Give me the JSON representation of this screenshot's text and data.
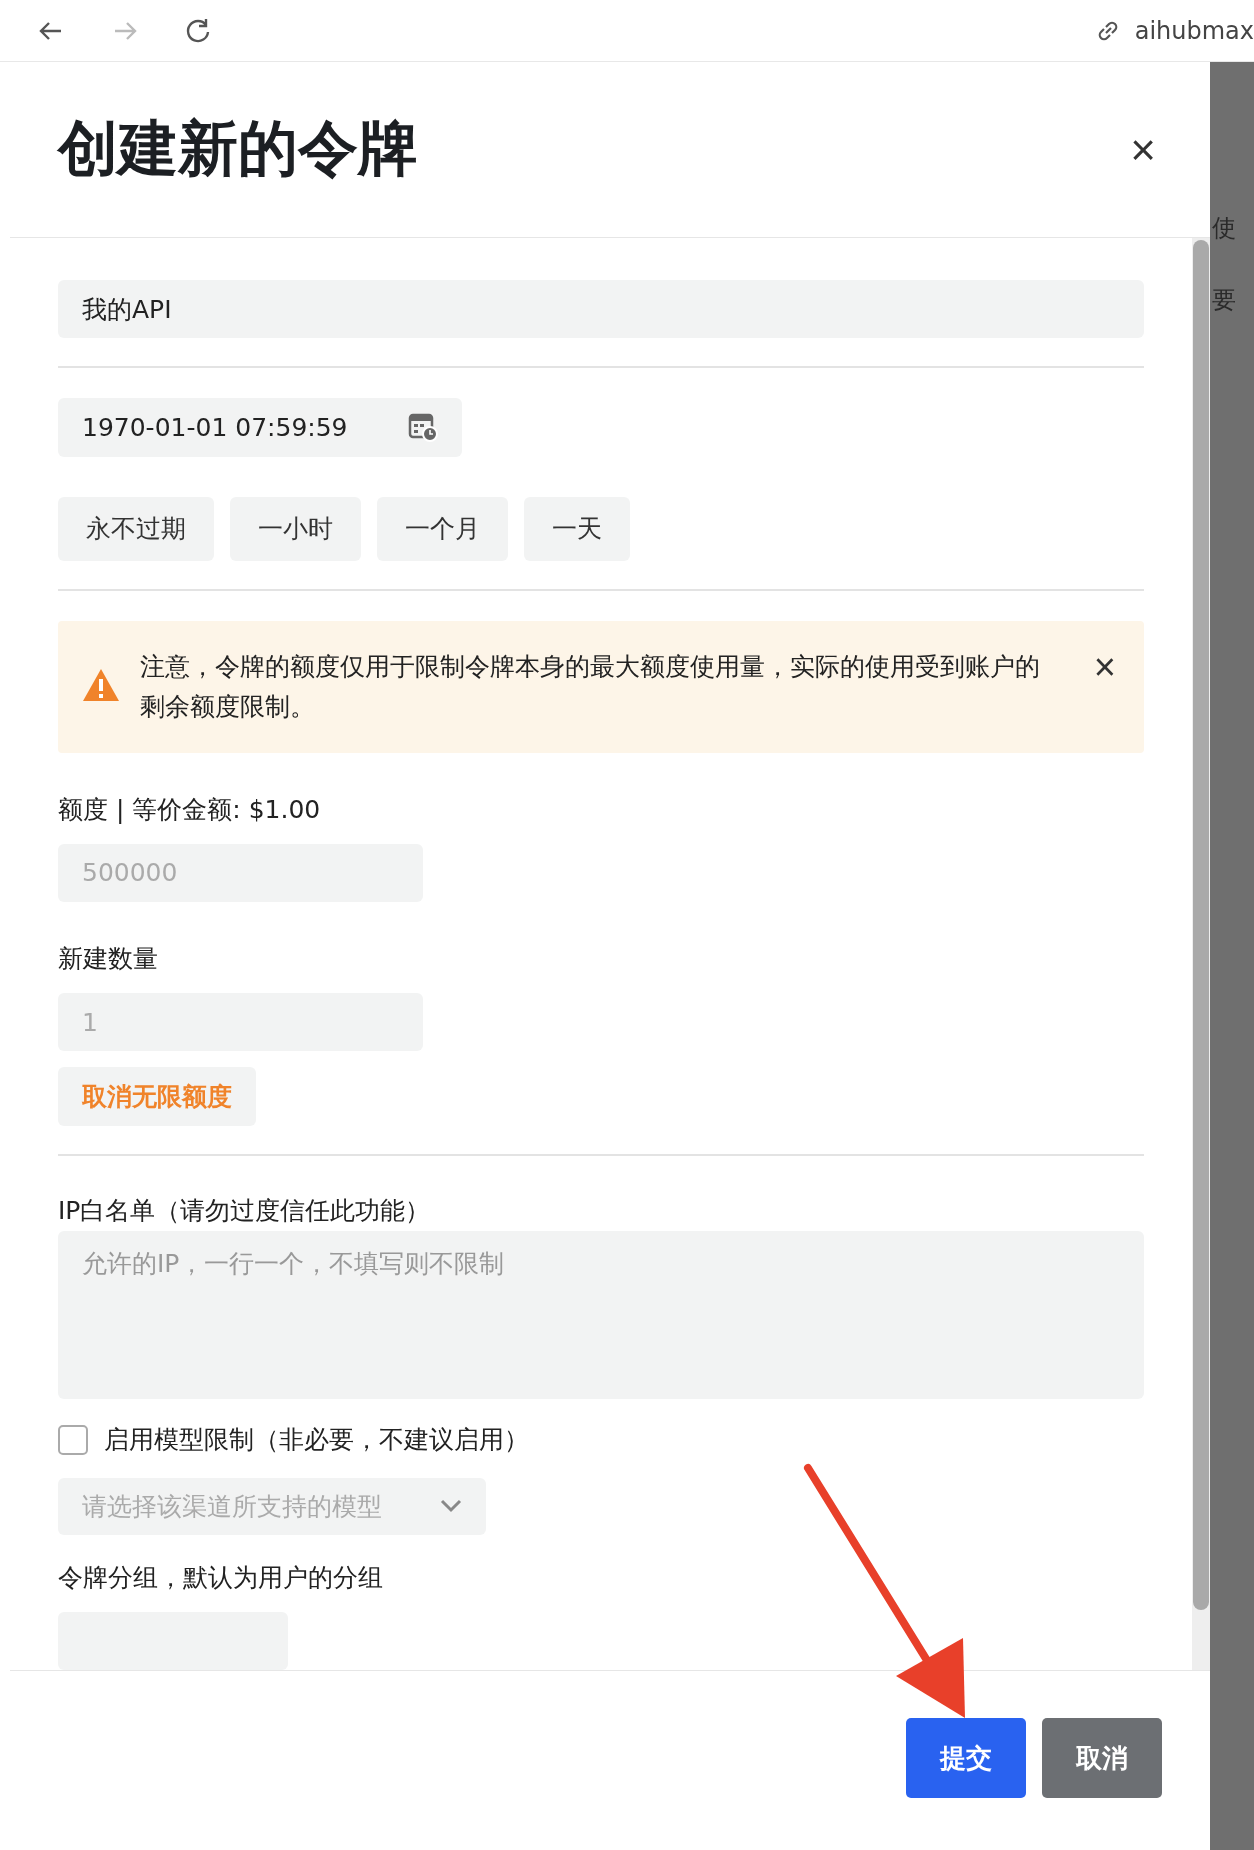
{
  "browser": {
    "address": "aihubmax"
  },
  "background": {
    "texts": [
      "使",
      "要"
    ]
  },
  "modal": {
    "title": "创建新的令牌",
    "close": "×"
  },
  "form": {
    "name_value": "我的API",
    "expiry_value": "1970-01-01 07:59:59",
    "expiry_presets": [
      "永不过期",
      "一小时",
      "一个月",
      "一天"
    ],
    "alert": {
      "text": "注意，令牌的额度仅用于限制令牌本身的最大额度使用量，实际的使用受到账户的剩余额度限制。",
      "close": "×"
    },
    "quota_label": "额度 | 等价金额: $1.00",
    "quota_placeholder": "500000",
    "count_label": "新建数量",
    "count_placeholder": "1",
    "unlimited_button": "取消无限额度",
    "ip_label": "IP白名单（请勿过度信任此功能）",
    "ip_placeholder": "允许的IP，一行一个，不填写则不限制",
    "model_limit": {
      "label": "启用模型限制（非必要，不建议启用）",
      "checked": false
    },
    "model_select_placeholder": "请选择该渠道所支持的模型",
    "group_label": "令牌分组，默认为用户的分组"
  },
  "buttons": [
    {
      "label": "提交",
      "kind": "primary"
    },
    {
      "label": "取消",
      "kind": "secondary"
    }
  ]
}
